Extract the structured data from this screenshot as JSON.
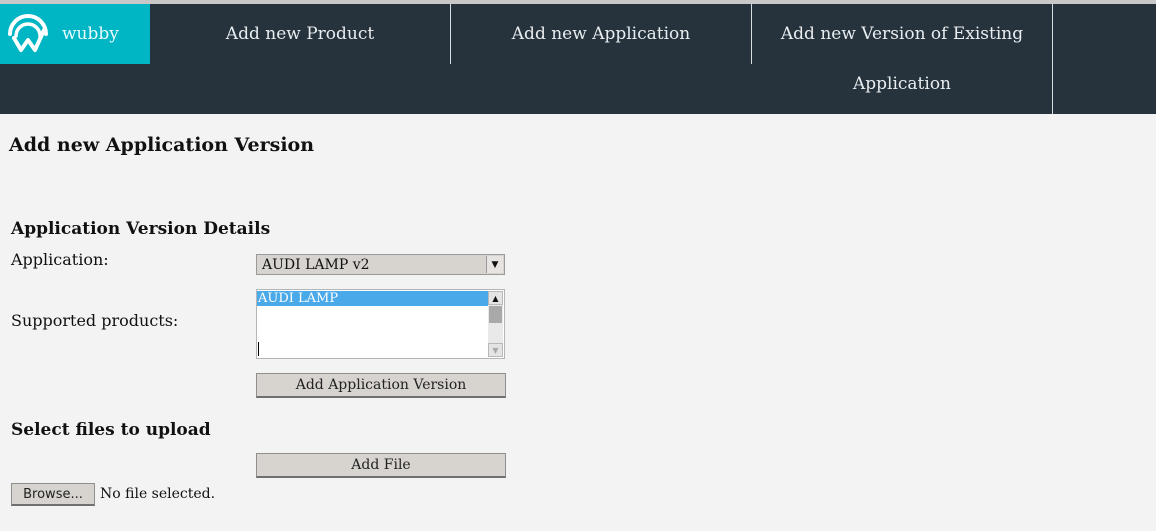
{
  "brand": {
    "name": "wubby",
    "logo_icon": "wubby-logo-icon",
    "color": "#00b5c4"
  },
  "nav": {
    "background": "#27333c",
    "items": [
      {
        "label": "Add new Product"
      },
      {
        "label": "Add new Application"
      },
      {
        "label": "Add new Version of Existing",
        "label_line2": "Application"
      }
    ]
  },
  "page": {
    "title": "Add new Application Version"
  },
  "details": {
    "heading": "Application Version Details",
    "application_label": "Application:",
    "application_value": "AUDI LAMP v2",
    "products_label": "Supported products:",
    "products_options": [
      "AUDI LAMP"
    ],
    "add_version_button": "Add Application Version"
  },
  "upload": {
    "heading": "Select files to upload",
    "add_file_button": "Add File",
    "browse_button": "Browse...",
    "file_status": "No file selected."
  }
}
